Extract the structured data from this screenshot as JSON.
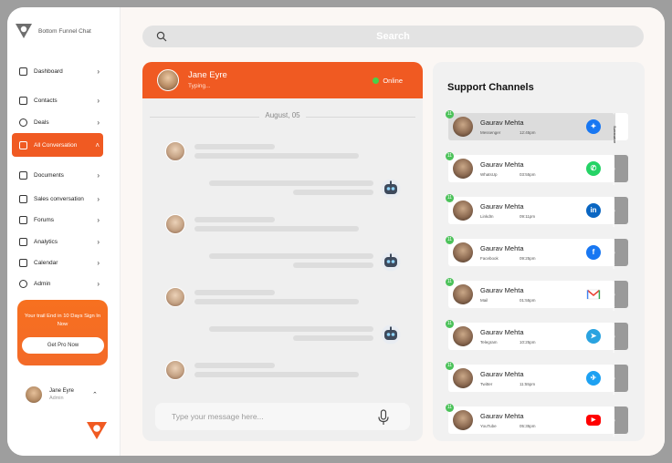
{
  "brand": {
    "name": "Bottom Funnel Chat"
  },
  "search": {
    "label": "Search"
  },
  "sidebar": {
    "items": [
      {
        "label": "Dashboard",
        "icon": "trend-icon"
      },
      {
        "label": "Contacts",
        "icon": "contacts-icon"
      },
      {
        "label": "Deals",
        "icon": "dollar-icon"
      },
      {
        "label": "All Conversation",
        "icon": "cube-icon",
        "active": true
      },
      {
        "label": "Documents",
        "icon": "document-icon"
      },
      {
        "label": "Sales conversation",
        "icon": "chat-icon"
      },
      {
        "label": "Forums",
        "icon": "forum-icon"
      },
      {
        "label": "Analytics",
        "icon": "chart-icon"
      },
      {
        "label": "Calendar",
        "icon": "calendar-icon"
      },
      {
        "label": "Admin",
        "icon": "lock-icon"
      }
    ]
  },
  "promo": {
    "text": "Your trail End in 10 Days Sign In Now",
    "button": "Get Pro Now"
  },
  "profile": {
    "name": "Jane Eyre",
    "role": "Admin"
  },
  "chat": {
    "name": "Jane Eyre",
    "status_text": "Typing...",
    "online_label": "Online",
    "date": "August, 05",
    "composer_placeholder": "Type your message here..."
  },
  "support": {
    "title": "Support Channels",
    "summarize_label": "Summarize",
    "channels": [
      {
        "name": "Gaurav Mehta",
        "source": "Messenger",
        "time": "12:45pm",
        "badge": "11",
        "icon": "messenger-icon",
        "color": "#1877f2",
        "selected": true
      },
      {
        "name": "Gaurav Mehta",
        "source": "WhatsUp",
        "time": "03:55pm",
        "badge": "11",
        "icon": "whatsapp-icon",
        "color": "#25d366"
      },
      {
        "name": "Gaurav Mehta",
        "source": "LinkdIn",
        "time": "09:11pm",
        "badge": "11",
        "icon": "linkedin-icon",
        "color": "#0a66c2"
      },
      {
        "name": "Gaurav Mehta",
        "source": "Facebook",
        "time": "09:25pm",
        "badge": "11",
        "icon": "facebook-icon",
        "color": "#1877f2"
      },
      {
        "name": "Gaurav Mehta",
        "source": "Mail",
        "time": "01:55pm",
        "badge": "11",
        "icon": "gmail-icon",
        "color": "#ffffff"
      },
      {
        "name": "Gaurav Mehta",
        "source": "Telegram",
        "time": "10:25pm",
        "badge": "11",
        "icon": "telegram-icon",
        "color": "#2aa3e0"
      },
      {
        "name": "Gaurav Mehta",
        "source": "Twitter",
        "time": "11:55pm",
        "badge": "11",
        "icon": "twitter-icon",
        "color": "#1da1f2"
      },
      {
        "name": "Gaurav Mehta",
        "source": "YouTube",
        "time": "05:35pm",
        "badge": "11",
        "icon": "youtube-icon",
        "color": "#ff0000"
      }
    ]
  }
}
